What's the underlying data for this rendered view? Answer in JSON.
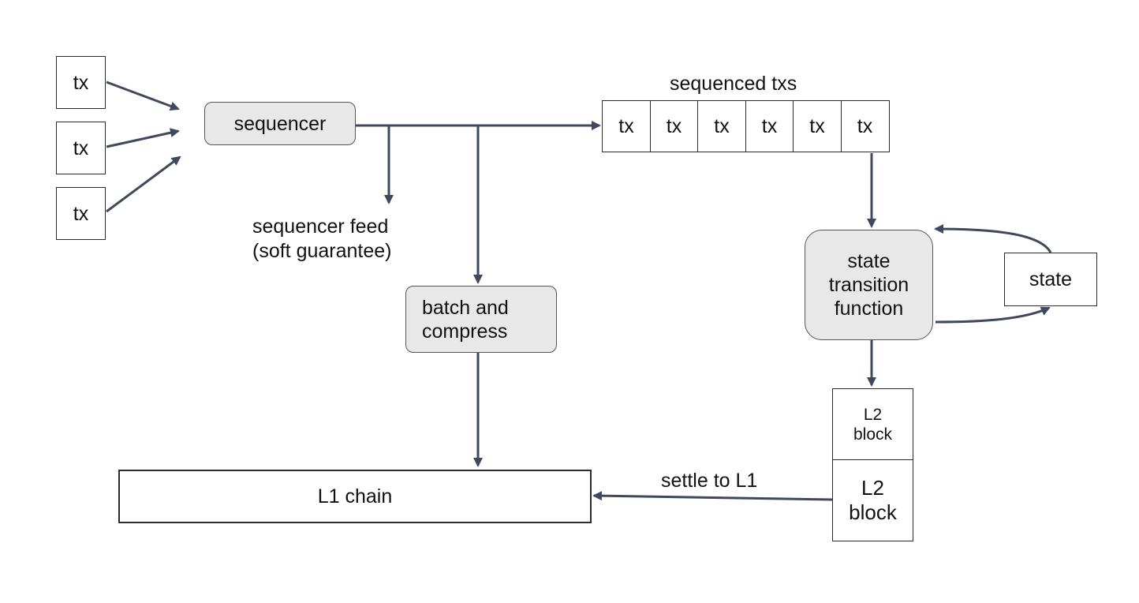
{
  "diagram": {
    "input_txs": [
      "tx",
      "tx",
      "tx"
    ],
    "sequencer": "sequencer",
    "sequenced_txs_label": "sequenced txs",
    "sequenced_txs": [
      "tx",
      "tx",
      "tx",
      "tx",
      "tx",
      "tx"
    ],
    "sequencer_feed": {
      "line1": "sequencer feed",
      "line2": "(soft guarantee)"
    },
    "batch_compress": {
      "line1": "batch and",
      "line2": "compress"
    },
    "stf": {
      "line1": "state",
      "line2": "transition",
      "line3": "function"
    },
    "state": "state",
    "l2_blocks": [
      {
        "line1": "L2",
        "line2": "block"
      },
      {
        "line1": "L2",
        "line2": "block"
      }
    ],
    "settle_label": "settle to L1",
    "l1_chain": "L1 chain",
    "colors": {
      "arrow": "#3e4a5c",
      "node_fill": "#e8e8e8",
      "border": "#2b2b2b"
    }
  }
}
